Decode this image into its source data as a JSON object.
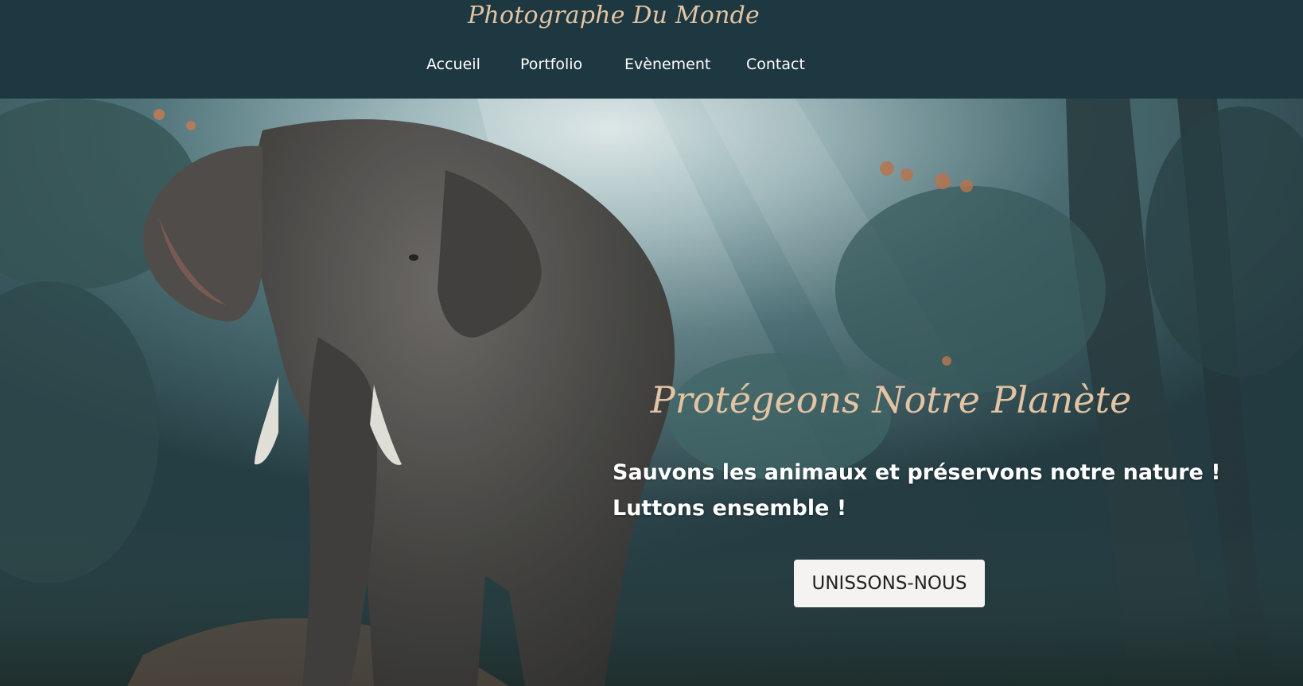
{
  "header": {
    "brand": "Photographe Du Monde",
    "nav": [
      {
        "label": "Accueil"
      },
      {
        "label": "Portfolio"
      },
      {
        "label": "Evènement"
      },
      {
        "label": "Contact"
      }
    ]
  },
  "hero": {
    "image": "elephant-in-misty-forest",
    "title": "Protégeons Notre Planète",
    "subtitle_lines": [
      "Sauvons les animaux et préservons notre nature !",
      "Luttons ensemble !"
    ],
    "cta_label": "UNISSONS-NOUS"
  },
  "colors": {
    "header_bg": "#1d3840",
    "accent_gold": "#e2c3a3",
    "nav_text": "#ffffff",
    "button_bg": "#f4f3f1"
  }
}
